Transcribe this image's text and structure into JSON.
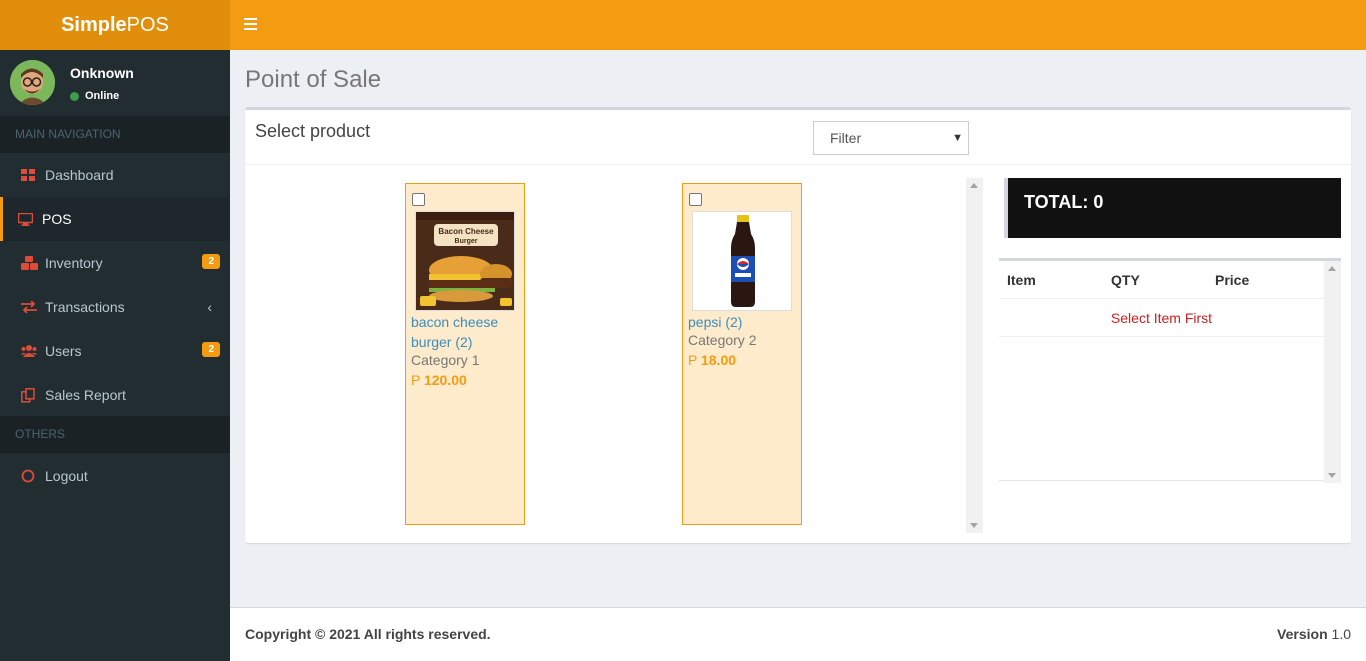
{
  "brand": {
    "bold": "Simple",
    "light": "POS"
  },
  "user": {
    "name": "Onknown",
    "status": "Online"
  },
  "nav": {
    "main_header": "MAIN NAVIGATION",
    "items": [
      {
        "label": "Dashboard"
      },
      {
        "label": "POS"
      },
      {
        "label": "Inventory",
        "badge": "2"
      },
      {
        "label": "Transactions"
      },
      {
        "label": "Users",
        "badge": "2"
      },
      {
        "label": "Sales Report"
      }
    ],
    "others_header": "OTHERS",
    "logout": "Logout"
  },
  "page": {
    "title": "Point of Sale"
  },
  "products_box": {
    "title": "Select product",
    "filter": "Filter",
    "products": [
      {
        "name": "bacon cheese burger (2)",
        "category": "Category 1",
        "currency": "P",
        "price": "120.00",
        "image_text_1": "Bacon Cheese",
        "image_text_2": "Burger"
      },
      {
        "name": "pepsi (2)",
        "category": "Category 2",
        "currency": "P",
        "price": "18.00"
      }
    ]
  },
  "cart": {
    "total": "TOTAL: 0",
    "columns": [
      "Item",
      "QTY",
      "Price"
    ],
    "empty_message": "Select Item First"
  },
  "footer": {
    "copyright": "Copyright © 2021 All rights reserved.",
    "version_label": "Version",
    "version_value": "1.0"
  },
  "colors": {
    "accent": "#f39c12",
    "accent_dark": "#e08e0b",
    "sidebar": "#222d32",
    "link": "#3c8dbc",
    "error": "#c91f1f"
  }
}
